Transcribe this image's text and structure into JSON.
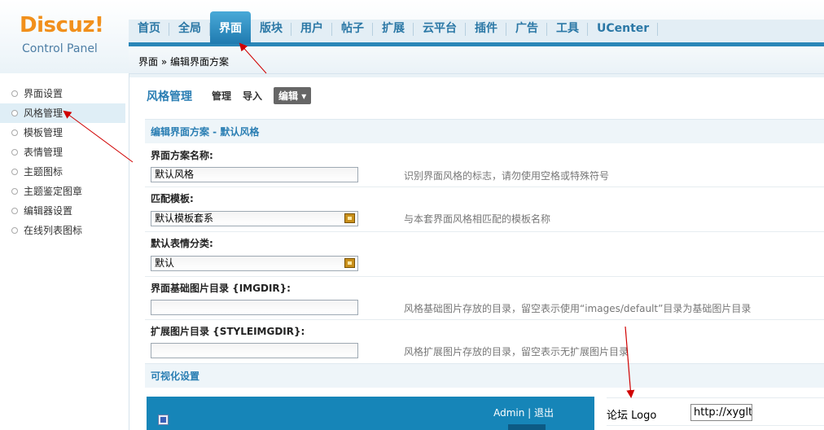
{
  "brand": {
    "name": "Discuz!",
    "subtitle": "Control Panel",
    "accent": "#f1901c"
  },
  "topnav": {
    "items": [
      {
        "label": "首页"
      },
      {
        "label": "全局"
      },
      {
        "label": "界面",
        "active": true
      },
      {
        "label": "版块"
      },
      {
        "label": "用户"
      },
      {
        "label": "帖子"
      },
      {
        "label": "扩展"
      },
      {
        "label": "云平台"
      },
      {
        "label": "插件"
      },
      {
        "label": "广告"
      },
      {
        "label": "工具"
      },
      {
        "label": "UCenter"
      }
    ]
  },
  "breadcrumb": {
    "text": "界面 » 编辑界面方案"
  },
  "sidebar": {
    "items": [
      {
        "label": "界面设置"
      },
      {
        "label": "风格管理",
        "active": true
      },
      {
        "label": "模板管理"
      },
      {
        "label": "表情管理"
      },
      {
        "label": "主题图标"
      },
      {
        "label": "主题鉴定图章"
      },
      {
        "label": "编辑器设置"
      },
      {
        "label": "在线列表图标"
      }
    ]
  },
  "main": {
    "title": "风格管理",
    "tabs": {
      "manage": "管理",
      "import": "导入",
      "edit": "编辑 ▾"
    },
    "section_title": "编辑界面方案 - 默认风格",
    "fields": {
      "scheme_name": {
        "label": "界面方案名称:",
        "value": "默认风格",
        "hint": "识别界面风格的标志，请勿使用空格或特殊符号"
      },
      "template": {
        "label": "匹配模板:",
        "value": "默认模板套系",
        "hint": "与本套界面风格相匹配的模板名称"
      },
      "smiley": {
        "label": "默认表情分类:",
        "value": "默认"
      },
      "imgdir": {
        "label": "界面基础图片目录 {IMGDIR}:",
        "value": "",
        "hint": "风格基础图片存放的目录，留空表示使用“images/default”目录为基础图片目录"
      },
      "styleimgdir": {
        "label": "扩展图片目录 {STYLEIMGDIR}:",
        "value": "",
        "hint": "风格扩展图片存放的目录，留空表示无扩展图片目录"
      }
    },
    "visual_section_title": "可视化设置",
    "preview": {
      "user_links": "Admin | 退出"
    },
    "logo_setting": {
      "label": "论坛 Logo",
      "value": "http://xyglt"
    }
  },
  "colors": {
    "nav_active": "#2a86b8",
    "link": "#2a7eb3",
    "annotation_arrow": "#d00000"
  }
}
